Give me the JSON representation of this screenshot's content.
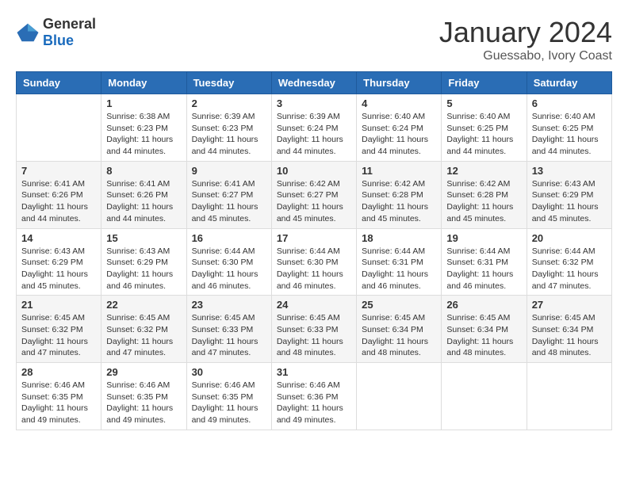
{
  "logo": {
    "general": "General",
    "blue": "Blue"
  },
  "title": "January 2024",
  "location": "Guessabo, Ivory Coast",
  "days_of_week": [
    "Sunday",
    "Monday",
    "Tuesday",
    "Wednesday",
    "Thursday",
    "Friday",
    "Saturday"
  ],
  "weeks": [
    [
      {
        "day": "",
        "sunrise": "",
        "sunset": "",
        "daylight": ""
      },
      {
        "day": "1",
        "sunrise": "Sunrise: 6:38 AM",
        "sunset": "Sunset: 6:23 PM",
        "daylight": "Daylight: 11 hours and 44 minutes."
      },
      {
        "day": "2",
        "sunrise": "Sunrise: 6:39 AM",
        "sunset": "Sunset: 6:23 PM",
        "daylight": "Daylight: 11 hours and 44 minutes."
      },
      {
        "day": "3",
        "sunrise": "Sunrise: 6:39 AM",
        "sunset": "Sunset: 6:24 PM",
        "daylight": "Daylight: 11 hours and 44 minutes."
      },
      {
        "day": "4",
        "sunrise": "Sunrise: 6:40 AM",
        "sunset": "Sunset: 6:24 PM",
        "daylight": "Daylight: 11 hours and 44 minutes."
      },
      {
        "day": "5",
        "sunrise": "Sunrise: 6:40 AM",
        "sunset": "Sunset: 6:25 PM",
        "daylight": "Daylight: 11 hours and 44 minutes."
      },
      {
        "day": "6",
        "sunrise": "Sunrise: 6:40 AM",
        "sunset": "Sunset: 6:25 PM",
        "daylight": "Daylight: 11 hours and 44 minutes."
      }
    ],
    [
      {
        "day": "7",
        "sunrise": "Sunrise: 6:41 AM",
        "sunset": "Sunset: 6:26 PM",
        "daylight": "Daylight: 11 hours and 44 minutes."
      },
      {
        "day": "8",
        "sunrise": "Sunrise: 6:41 AM",
        "sunset": "Sunset: 6:26 PM",
        "daylight": "Daylight: 11 hours and 44 minutes."
      },
      {
        "day": "9",
        "sunrise": "Sunrise: 6:41 AM",
        "sunset": "Sunset: 6:27 PM",
        "daylight": "Daylight: 11 hours and 45 minutes."
      },
      {
        "day": "10",
        "sunrise": "Sunrise: 6:42 AM",
        "sunset": "Sunset: 6:27 PM",
        "daylight": "Daylight: 11 hours and 45 minutes."
      },
      {
        "day": "11",
        "sunrise": "Sunrise: 6:42 AM",
        "sunset": "Sunset: 6:28 PM",
        "daylight": "Daylight: 11 hours and 45 minutes."
      },
      {
        "day": "12",
        "sunrise": "Sunrise: 6:42 AM",
        "sunset": "Sunset: 6:28 PM",
        "daylight": "Daylight: 11 hours and 45 minutes."
      },
      {
        "day": "13",
        "sunrise": "Sunrise: 6:43 AM",
        "sunset": "Sunset: 6:29 PM",
        "daylight": "Daylight: 11 hours and 45 minutes."
      }
    ],
    [
      {
        "day": "14",
        "sunrise": "Sunrise: 6:43 AM",
        "sunset": "Sunset: 6:29 PM",
        "daylight": "Daylight: 11 hours and 45 minutes."
      },
      {
        "day": "15",
        "sunrise": "Sunrise: 6:43 AM",
        "sunset": "Sunset: 6:29 PM",
        "daylight": "Daylight: 11 hours and 46 minutes."
      },
      {
        "day": "16",
        "sunrise": "Sunrise: 6:44 AM",
        "sunset": "Sunset: 6:30 PM",
        "daylight": "Daylight: 11 hours and 46 minutes."
      },
      {
        "day": "17",
        "sunrise": "Sunrise: 6:44 AM",
        "sunset": "Sunset: 6:30 PM",
        "daylight": "Daylight: 11 hours and 46 minutes."
      },
      {
        "day": "18",
        "sunrise": "Sunrise: 6:44 AM",
        "sunset": "Sunset: 6:31 PM",
        "daylight": "Daylight: 11 hours and 46 minutes."
      },
      {
        "day": "19",
        "sunrise": "Sunrise: 6:44 AM",
        "sunset": "Sunset: 6:31 PM",
        "daylight": "Daylight: 11 hours and 46 minutes."
      },
      {
        "day": "20",
        "sunrise": "Sunrise: 6:44 AM",
        "sunset": "Sunset: 6:32 PM",
        "daylight": "Daylight: 11 hours and 47 minutes."
      }
    ],
    [
      {
        "day": "21",
        "sunrise": "Sunrise: 6:45 AM",
        "sunset": "Sunset: 6:32 PM",
        "daylight": "Daylight: 11 hours and 47 minutes."
      },
      {
        "day": "22",
        "sunrise": "Sunrise: 6:45 AM",
        "sunset": "Sunset: 6:32 PM",
        "daylight": "Daylight: 11 hours and 47 minutes."
      },
      {
        "day": "23",
        "sunrise": "Sunrise: 6:45 AM",
        "sunset": "Sunset: 6:33 PM",
        "daylight": "Daylight: 11 hours and 47 minutes."
      },
      {
        "day": "24",
        "sunrise": "Sunrise: 6:45 AM",
        "sunset": "Sunset: 6:33 PM",
        "daylight": "Daylight: 11 hours and 48 minutes."
      },
      {
        "day": "25",
        "sunrise": "Sunrise: 6:45 AM",
        "sunset": "Sunset: 6:34 PM",
        "daylight": "Daylight: 11 hours and 48 minutes."
      },
      {
        "day": "26",
        "sunrise": "Sunrise: 6:45 AM",
        "sunset": "Sunset: 6:34 PM",
        "daylight": "Daylight: 11 hours and 48 minutes."
      },
      {
        "day": "27",
        "sunrise": "Sunrise: 6:45 AM",
        "sunset": "Sunset: 6:34 PM",
        "daylight": "Daylight: 11 hours and 48 minutes."
      }
    ],
    [
      {
        "day": "28",
        "sunrise": "Sunrise: 6:46 AM",
        "sunset": "Sunset: 6:35 PM",
        "daylight": "Daylight: 11 hours and 49 minutes."
      },
      {
        "day": "29",
        "sunrise": "Sunrise: 6:46 AM",
        "sunset": "Sunset: 6:35 PM",
        "daylight": "Daylight: 11 hours and 49 minutes."
      },
      {
        "day": "30",
        "sunrise": "Sunrise: 6:46 AM",
        "sunset": "Sunset: 6:35 PM",
        "daylight": "Daylight: 11 hours and 49 minutes."
      },
      {
        "day": "31",
        "sunrise": "Sunrise: 6:46 AM",
        "sunset": "Sunset: 6:36 PM",
        "daylight": "Daylight: 11 hours and 49 minutes."
      },
      {
        "day": "",
        "sunrise": "",
        "sunset": "",
        "daylight": ""
      },
      {
        "day": "",
        "sunrise": "",
        "sunset": "",
        "daylight": ""
      },
      {
        "day": "",
        "sunrise": "",
        "sunset": "",
        "daylight": ""
      }
    ]
  ]
}
